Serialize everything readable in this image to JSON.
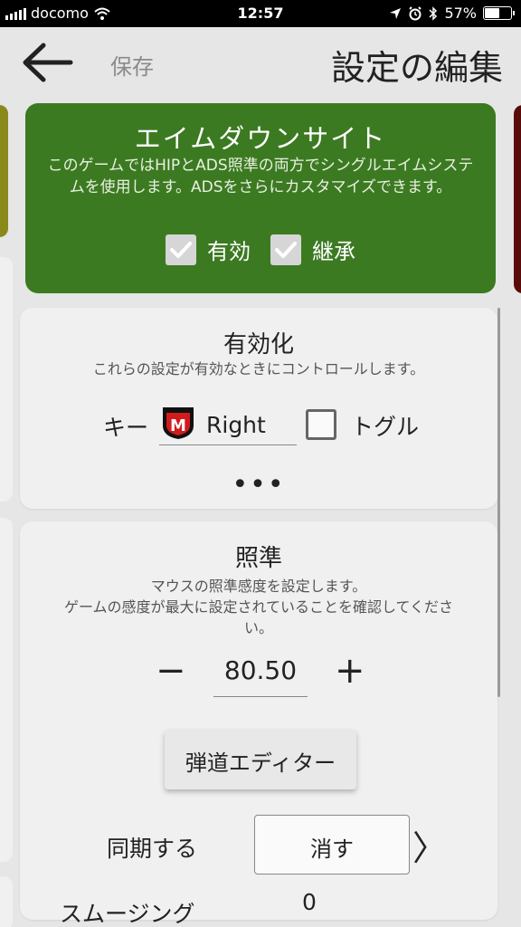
{
  "status_bar": {
    "carrier": "docomo",
    "time": "12:57",
    "battery_percent": "57%",
    "battery_level": 0.57,
    "icons": [
      "signal-icon",
      "wifi-icon",
      "location-icon",
      "alarm-icon",
      "bluetooth-icon",
      "battery-icon"
    ]
  },
  "header": {
    "back_icon": "arrow-left-icon",
    "save_label": "保存",
    "title": "設定の編集"
  },
  "colors": {
    "green_card": "#3c7a22",
    "left_peek": "#8a8a1a",
    "right_peek": "#5a0a0a",
    "card_bg": "#f0f0f0",
    "key_badge_red": "#d01c1c"
  },
  "aim_down_sight": {
    "title": "エイムダウンサイト",
    "description": "このゲームではHIPとADS照準の両方でシングルエイムシステムを使用します。ADSをさらにカスタマイズできます。",
    "enabled_label": "有効",
    "enabled_checked": true,
    "inherit_label": "継承",
    "inherit_checked": true
  },
  "activation": {
    "title": "有効化",
    "description": "これらの設定が有効なときにコントロールします。",
    "key_label": "キー",
    "key_badge_letter": "M",
    "key_value": "Right",
    "toggle_label": "トグル",
    "toggle_checked": false,
    "more_label": "•••"
  },
  "aim": {
    "title": "照準",
    "description_line1": "マウスの照準感度を設定します。",
    "description_line2": "ゲームの感度が最大に設定されていることを確認してください。",
    "minus_label": "−",
    "value": "80.50",
    "plus_label": "+",
    "ballistics_button": "弾道エディター",
    "sync_label": "同期する",
    "clear_button": "消す",
    "chevron": "〉",
    "partial_row_label": "スムージング",
    "partial_row_value": "0"
  }
}
